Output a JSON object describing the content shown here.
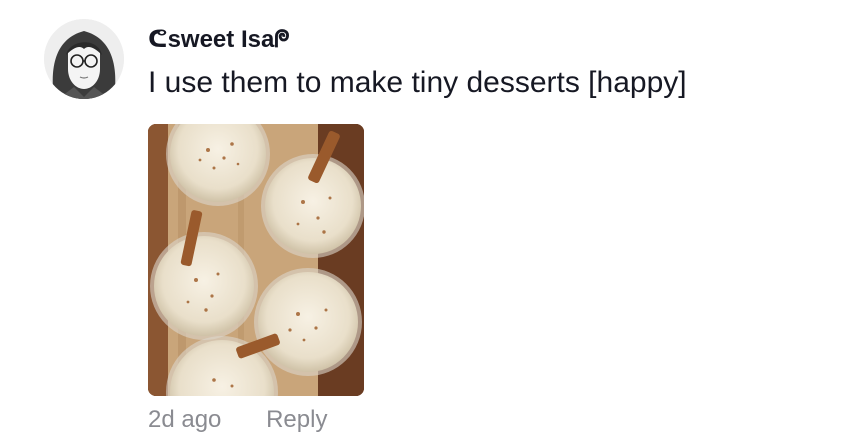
{
  "comment": {
    "username": "ᕦsweet Isaᖘ",
    "text": "I use them to make tiny desserts [happy]",
    "timestamp": "2d ago",
    "reply_label": "Reply"
  }
}
